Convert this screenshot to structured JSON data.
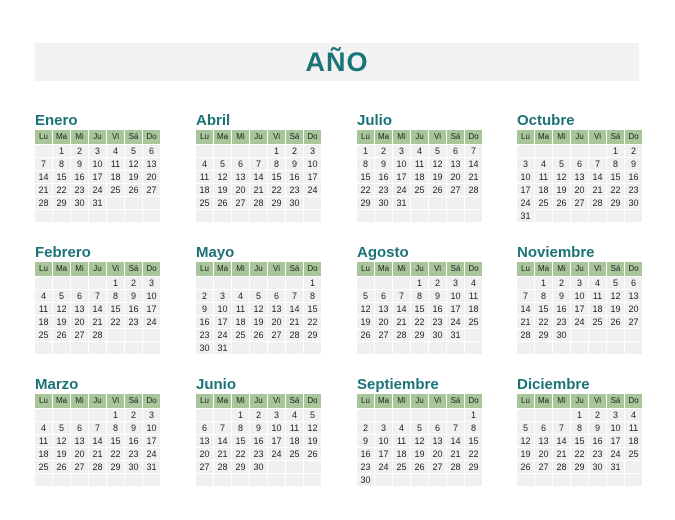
{
  "title": "AÑO",
  "weekdays": [
    "Lu",
    "Ma",
    "Mi",
    "Ju",
    "Vi",
    "Sá",
    "Do"
  ],
  "months": [
    {
      "name": "Enero",
      "start": 1,
      "days": 31
    },
    {
      "name": "Abril",
      "start": 4,
      "days": 30
    },
    {
      "name": "Julio",
      "start": 0,
      "days": 31
    },
    {
      "name": "Octubre",
      "start": 5,
      "days": 31
    },
    {
      "name": "Febrero",
      "start": 4,
      "days": 28
    },
    {
      "name": "Mayo",
      "start": 6,
      "days": 31
    },
    {
      "name": "Agosto",
      "start": 3,
      "days": 31
    },
    {
      "name": "Noviembre",
      "start": 1,
      "days": 30
    },
    {
      "name": "Marzo",
      "start": 4,
      "days": 31
    },
    {
      "name": "Junio",
      "start": 2,
      "days": 30
    },
    {
      "name": "Septiembre",
      "start": 6,
      "days": 30
    },
    {
      "name": "Diciembre",
      "start": 3,
      "days": 31
    }
  ]
}
